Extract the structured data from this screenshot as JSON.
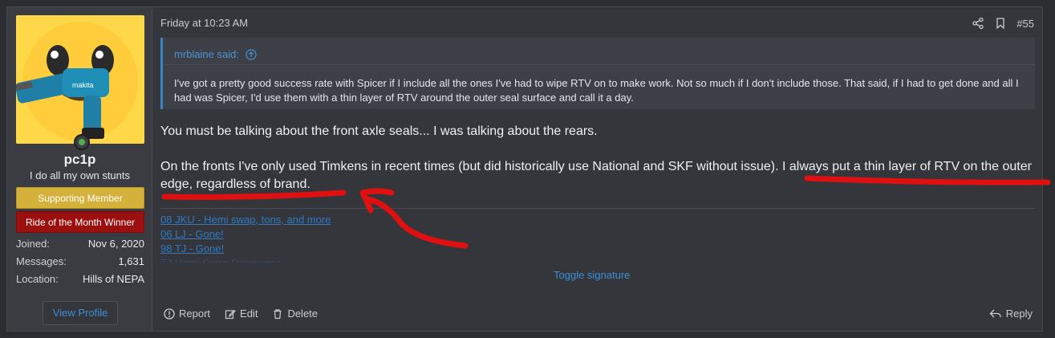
{
  "user": {
    "username": "pc1p",
    "title": "I do all my own stunts",
    "banners": [
      "Supporting Member",
      "Ride of the Month Winner"
    ],
    "stats": [
      {
        "label": "Joined:",
        "value": "Nov 6, 2020"
      },
      {
        "label": "Messages:",
        "value": "1,631"
      },
      {
        "label": "Location:",
        "value": "Hills of NEPA"
      }
    ],
    "view_profile": "View Profile"
  },
  "post": {
    "date": "Friday at 10:23 AM",
    "number": "#55",
    "quote": {
      "author_text": "mrblaine said:",
      "body": "I've got a pretty good success rate with Spicer if I include all the ones I've had to wipe RTV on to make work. Not so much if I don't include those. That said, if I had to get done and all I had was Spicer, I'd use them with a thin layer of RTV around the outer seal surface and call it a day."
    },
    "paragraphs": [
      "You must be talking about the front axle seals... I was talking about the rears.",
      "On the fronts I've only used Timkens in recent times (but did historically use National and SKF without issue). I always put a thin layer of RTV on the outer edge, regardless of brand."
    ],
    "signature": [
      "08 JKU - Hemi swap, tons, and more",
      "06 LJ - Gone!",
      "98 TJ - Gone!",
      "TJ Hemi Swap Resources"
    ],
    "toggle_signature": "Toggle signature",
    "actions": {
      "report": "Report",
      "edit": "Edit",
      "delete": "Delete",
      "reply": "Reply"
    }
  },
  "colors": {
    "accent": "#3a8fd6",
    "supporting_banner": "#d4b13b",
    "ride_banner": "#9b0f0f",
    "annotation_red": "#e01010"
  },
  "icons": [
    "share-icon",
    "bookmark-icon",
    "arrow-up-circle-icon",
    "report-icon",
    "edit-icon",
    "trash-icon",
    "reply-icon"
  ]
}
